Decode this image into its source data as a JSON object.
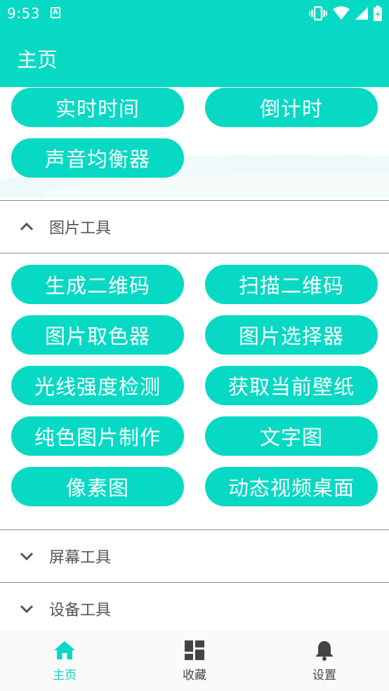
{
  "status": {
    "time": "9:53",
    "notif_letter": "A"
  },
  "header": {
    "title": "主页"
  },
  "top_buttons": [
    "实时时间",
    "倒计时",
    "声音均衡器"
  ],
  "sections": [
    {
      "label": "图片工具",
      "expanded": true,
      "items": [
        "生成二维码",
        "扫描二维码",
        "图片取色器",
        "图片选择器",
        "光线强度检测",
        "获取当前壁纸",
        "纯色图片制作",
        "文字图",
        "像素图",
        "动态视频桌面"
      ]
    },
    {
      "label": "屏幕工具",
      "expanded": false
    },
    {
      "label": "设备工具",
      "expanded": false
    }
  ],
  "bottom_nav": [
    {
      "label": "主页",
      "icon": "home-icon",
      "active": true
    },
    {
      "label": "收藏",
      "icon": "dashboard-icon",
      "active": false
    },
    {
      "label": "设置",
      "icon": "bell-icon",
      "active": false
    }
  ],
  "colors": {
    "accent": "#07d9c4",
    "divider": "#8c8c8c",
    "nav_bg": "#fafafa"
  }
}
